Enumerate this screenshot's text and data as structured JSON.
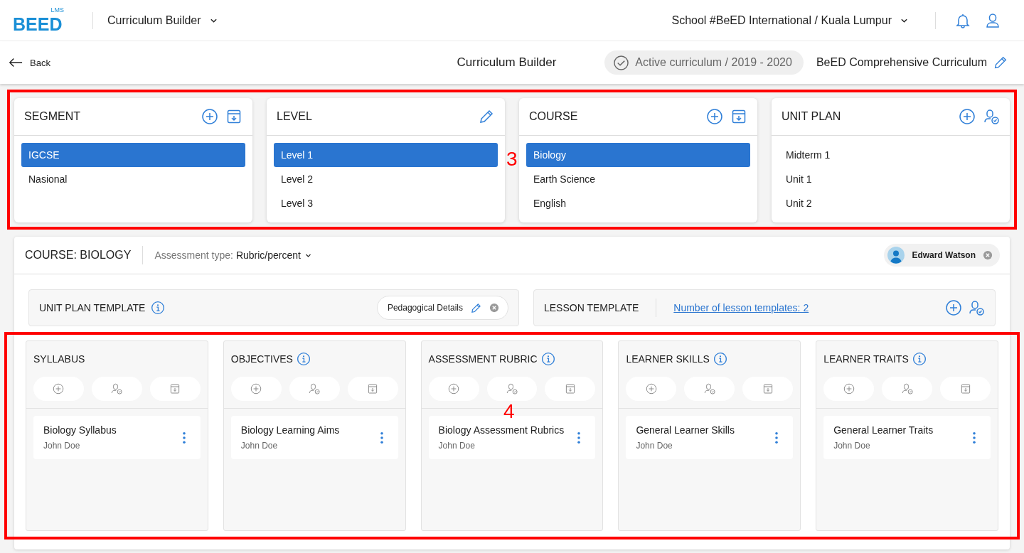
{
  "header": {
    "logo": {
      "mark": "BEED",
      "sub": "LMS"
    },
    "app_menu": "Curriculum Builder",
    "school": "School #BeED International / Kuala Lumpur"
  },
  "subheader": {
    "back": "Back",
    "title": "Curriculum Builder",
    "status": "Active curriculum / 2019 - 2020",
    "curriculum": "BeED Comprehensive Curriculum"
  },
  "selectors_annotation": "3",
  "selectors": [
    {
      "title": "SEGMENT",
      "actions": [
        {
          "kind": "add"
        },
        {
          "kind": "archive"
        }
      ],
      "items": [
        {
          "label": "IGCSE",
          "selected": true
        },
        {
          "label": "Nasional",
          "selected": false
        }
      ]
    },
    {
      "title": "LEVEL",
      "actions": [
        {
          "kind": "edit"
        }
      ],
      "items": [
        {
          "label": "Level 1",
          "selected": true
        },
        {
          "label": "Level 2",
          "selected": false
        },
        {
          "label": "Level 3",
          "selected": false
        }
      ]
    },
    {
      "title": "COURSE",
      "actions": [
        {
          "kind": "add"
        },
        {
          "kind": "archive"
        }
      ],
      "items": [
        {
          "label": "Biology",
          "selected": true
        },
        {
          "label": "Earth Science",
          "selected": false
        },
        {
          "label": "English",
          "selected": false
        }
      ]
    },
    {
      "title": "UNIT PLAN",
      "actions": [
        {
          "kind": "add"
        },
        {
          "kind": "assign"
        }
      ],
      "items": [
        {
          "label": "Midterm 1",
          "selected": false
        },
        {
          "label": "Unit 1",
          "selected": false
        },
        {
          "label": "Unit 2",
          "selected": false
        }
      ]
    }
  ],
  "course": {
    "title": "COURSE: BIOLOGY",
    "assessment_label": "Assessment type:",
    "assessment_value": "Rubric/percent",
    "user": "Edward Watson",
    "unit_plan_template": {
      "title": "UNIT PLAN TEMPLATE",
      "chip": "Pedagogical Details"
    },
    "lesson_template": {
      "title": "LESSON TEMPLATE",
      "link": "Number of lesson templates: 2"
    },
    "columns_annotation": "4",
    "columns": [
      {
        "title": "SYLLABUS",
        "info": false,
        "items": [
          {
            "title": "Biology Syllabus",
            "author": "John Doe"
          }
        ]
      },
      {
        "title": "OBJECTIVES",
        "info": true,
        "items": [
          {
            "title": "Biology Learning Aims",
            "author": "John Doe"
          }
        ]
      },
      {
        "title": "ASSESSMENT RUBRIC",
        "info": true,
        "items": [
          {
            "title": "Biology Assessment Rubrics",
            "author": "John Doe"
          }
        ]
      },
      {
        "title": "LEARNER SKILLS",
        "info": true,
        "items": [
          {
            "title": "General Learner Skills",
            "author": "John Doe"
          }
        ]
      },
      {
        "title": "LEARNER TRAITS",
        "info": true,
        "items": [
          {
            "title": "General Learner Traits",
            "author": "John Doe"
          }
        ]
      }
    ]
  }
}
